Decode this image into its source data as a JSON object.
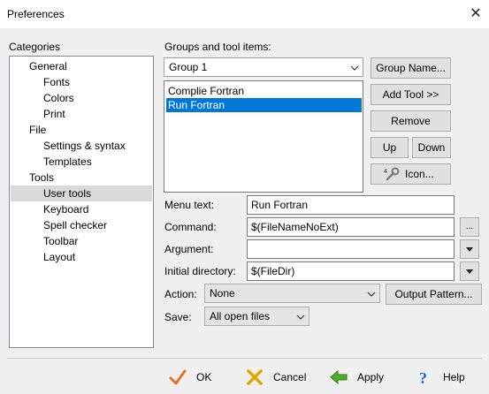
{
  "window": {
    "title": "Preferences",
    "close": "✕"
  },
  "categories": {
    "label": "Categories",
    "items": [
      {
        "label": "General",
        "level": 0
      },
      {
        "label": "Fonts",
        "level": 1
      },
      {
        "label": "Colors",
        "level": 1
      },
      {
        "label": "Print",
        "level": 1
      },
      {
        "label": "File",
        "level": 0
      },
      {
        "label": "Settings & syntax",
        "level": 1
      },
      {
        "label": "Templates",
        "level": 1
      },
      {
        "label": "Tools",
        "level": 0
      },
      {
        "label": "User tools",
        "level": 1,
        "selected": true
      },
      {
        "label": "Keyboard",
        "level": 1
      },
      {
        "label": "Spell checker",
        "level": 1
      },
      {
        "label": "Toolbar",
        "level": 1
      },
      {
        "label": "Layout",
        "level": 1
      }
    ]
  },
  "groups": {
    "label": "Groups and tool items:",
    "selected_group": "Group 1",
    "tools": [
      {
        "label": "Complie Fortran",
        "selected": false
      },
      {
        "label": "Run Fortran",
        "selected": true
      }
    ]
  },
  "buttons": {
    "group_name": "Group Name...",
    "add_tool": "Add Tool >>",
    "remove": "Remove",
    "up": "Up",
    "down": "Down",
    "icon": "Icon...",
    "output_pattern": "Output Pattern...",
    "browse": "...",
    "dropdown": "▼"
  },
  "fields": {
    "menu_text": {
      "label": "Menu text:",
      "value": "Run Fortran"
    },
    "command": {
      "label": "Command:",
      "value": "$(FileNameNoExt)"
    },
    "argument": {
      "label": "Argument:",
      "value": ""
    },
    "initial_directory": {
      "label": "Initial directory:",
      "value": "$(FileDir)"
    },
    "action": {
      "label": "Action:",
      "value": "None"
    },
    "save": {
      "label": "Save:",
      "value": "All open files"
    }
  },
  "footer": {
    "ok": "OK",
    "cancel": "Cancel",
    "apply": "Apply",
    "help": "Help"
  },
  "colors": {
    "selection": "#0078d7",
    "tree_selection": "#d9d9d9",
    "ok_icon": "#e8702a",
    "cancel_icon": "#e0a800",
    "apply_icon": "#4caf2a",
    "help_icon": "#1a66c9"
  }
}
